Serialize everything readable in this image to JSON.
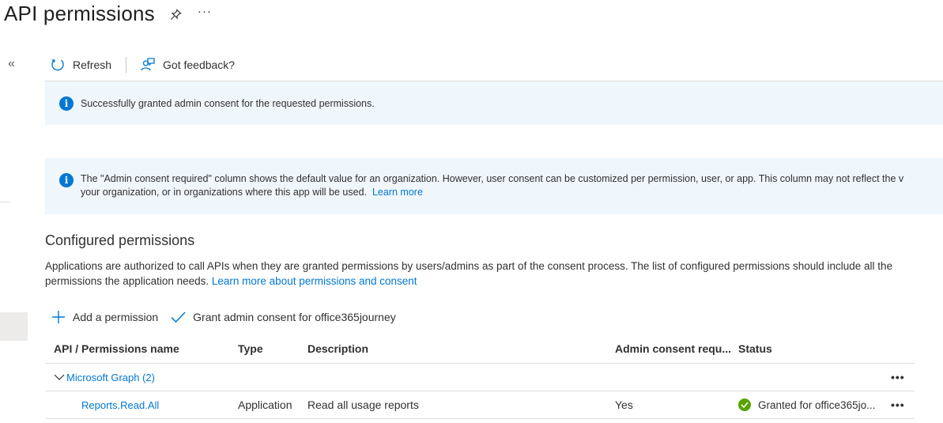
{
  "page": {
    "title": "API permissions",
    "more_label": "···"
  },
  "nav": {
    "collapse_label": "«"
  },
  "toolbar": {
    "refresh_label": "Refresh",
    "feedback_label": "Got feedback?"
  },
  "banners": {
    "success_text": "Successfully granted admin consent for the requested permissions.",
    "info_text_line1": "The \"Admin consent required\" column shows the default value for an organization. However, user consent can be customized per permission, user, or app. This column may not reflect the v",
    "info_text_line2": "your organization, or in organizations where this app will be used.",
    "info_link": "Learn more"
  },
  "configured": {
    "title": "Configured permissions",
    "description": "Applications are authorized to call APIs when they are granted permissions by users/admins as part of the consent process. The list of configured permissions should include all the permissions the application needs.",
    "link": "Learn more about permissions and consent",
    "add_label": "Add a permission",
    "grant_label": "Grant admin consent for office365journey"
  },
  "table": {
    "headers": {
      "name": "API / Permissions name",
      "type": "Type",
      "description": "Description",
      "admin": "Admin consent requ...",
      "status": "Status"
    },
    "group": {
      "label": "Microsoft Graph (2)",
      "more": "•••"
    },
    "rows": [
      {
        "name": "Reports.Read.All",
        "type": "Application",
        "description": "Read all usage reports",
        "admin": "Yes",
        "status": "Granted for office365jo...",
        "more": "•••"
      }
    ]
  },
  "colors": {
    "accent": "#0078d4",
    "banner_bg": "#eff6fc",
    "success": "#57a300"
  }
}
